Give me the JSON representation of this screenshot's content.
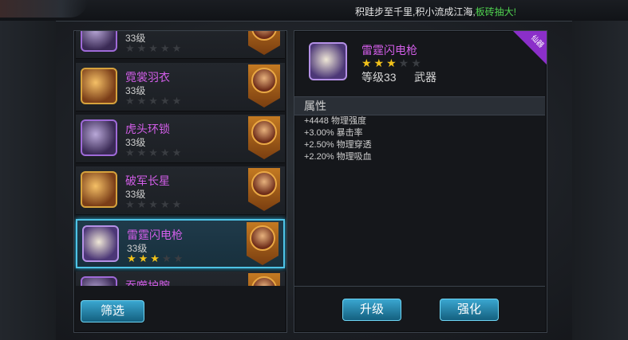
{
  "topbar": {
    "message_prefix": "积跬步至千里,积小流成江海,",
    "message_highlight": "板砖抽大!"
  },
  "list": {
    "items": [
      {
        "name": "",
        "level": "33级",
        "stars": 0
      },
      {
        "name": "霓裳羽衣",
        "level": "33级",
        "stars": 0
      },
      {
        "name": "虎头环锁",
        "level": "33级",
        "stars": 0
      },
      {
        "name": "破军长星",
        "level": "33级",
        "stars": 0
      },
      {
        "name": "雷霆闪电枪",
        "level": "33级",
        "stars": 3
      },
      {
        "name": "吞噬护腕",
        "level": "",
        "stars": 0
      }
    ],
    "filter_label": "筛选"
  },
  "detail": {
    "name": "雷霆闪电枪",
    "stars": 3,
    "level": "等级33",
    "type": "武器",
    "rarity": "仙器",
    "attributes_header": "属性",
    "attributes": [
      "+4448 物理强度",
      "+3.00% 暴击率",
      "+2.50% 物理穿透",
      "+2.20% 物理吸血"
    ],
    "upgrade_label": "升级",
    "enhance_label": "强化"
  }
}
